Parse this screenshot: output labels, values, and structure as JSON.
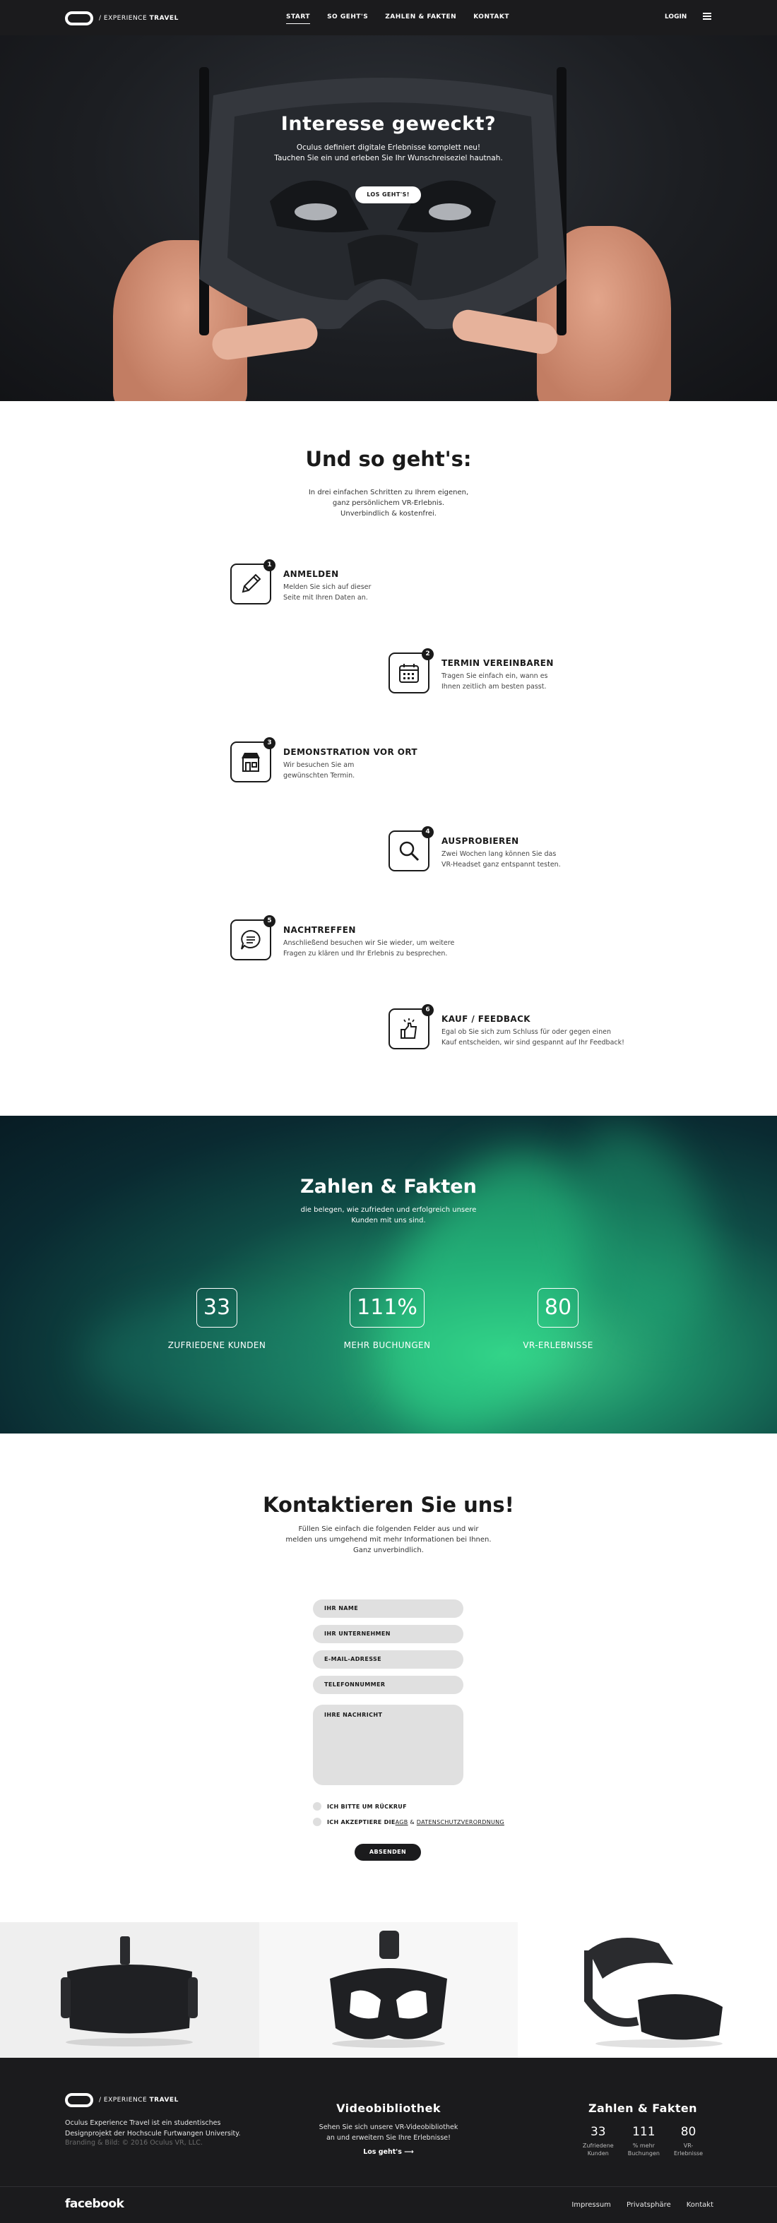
{
  "nav": {
    "logo_prefix": "/ EXPERIENCE ",
    "logo_bold": "TRAVEL",
    "links": [
      "START",
      "SO GEHT'S",
      "ZAHLEN & FAKTEN",
      "KONTAKT"
    ],
    "login": "LOGIN"
  },
  "hero": {
    "title": "Interesse geweckt?",
    "subtitle_line1": "Oculus definiert digitale Erlebnisse komplett neu!",
    "subtitle_line2": "Tauchen Sie ein und erleben Sie Ihr Wunschreiseziel hautnah.",
    "button": "LOS GEHT'S!"
  },
  "steps": {
    "title": "Und so geht's:",
    "subtitle_lines": [
      "In drei einfachen Schritten zu Ihrem eigenen,",
      "ganz persönlichem VR-Erlebnis.",
      "Unverbindlich & kostenfrei."
    ],
    "items": [
      {
        "num": "1",
        "title": "ANMELDEN",
        "desc_lines": [
          "Melden Sie sich auf dieser",
          "Seite mit Ihren Daten an."
        ],
        "icon": "pencil-icon"
      },
      {
        "num": "2",
        "title": "TERMIN VEREINBAREN",
        "desc_lines": [
          "Tragen Sie einfach ein, wann es",
          "Ihnen zeitlich am besten passt."
        ],
        "icon": "calendar-icon"
      },
      {
        "num": "3",
        "title": "DEMONSTRATION VOR ORT",
        "desc_lines": [
          "Wir besuchen Sie am",
          "gewünschten Termin."
        ],
        "icon": "store-icon"
      },
      {
        "num": "4",
        "title": "AUSPROBIEREN",
        "desc_lines": [
          "Zwei Wochen lang können Sie das",
          "VR-Headset ganz entspannt testen."
        ],
        "icon": "magnifier-icon"
      },
      {
        "num": "5",
        "title": "NACHTREFFEN",
        "desc_lines": [
          "Anschließend besuchen wir Sie wieder, um weitere",
          "Fragen zu klären und Ihr Erlebnis zu besprechen."
        ],
        "icon": "chat-icon"
      },
      {
        "num": "6",
        "title": "KAUF / FEEDBACK",
        "desc_lines": [
          "Egal ob Sie sich zum Schluss für oder gegen einen",
          "Kauf entscheiden, wir sind gespannt auf Ihr Feedback!"
        ],
        "icon": "thumbs-up-icon"
      }
    ]
  },
  "facts": {
    "title": "Zahlen & Fakten",
    "subtitle_lines": [
      "die belegen, wie zufrieden und erfolgreich unsere",
      "Kunden mit uns sind."
    ],
    "stats": [
      {
        "value": "33",
        "label": "ZUFRIEDENE KUNDEN"
      },
      {
        "value": "111%",
        "label": "MEHR BUCHUNGEN"
      },
      {
        "value": "80",
        "label": "VR-ERLEBNISSE"
      }
    ]
  },
  "contact": {
    "title": "Kontaktieren Sie uns!",
    "subtitle_lines": [
      "Füllen Sie einfach die folgenden Felder aus und wir",
      "melden uns umgehend mit mehr Informationen bei Ihnen.",
      "Ganz unverbindlich."
    ],
    "fields": [
      "IHR NAME",
      "IHR UNTERNEHMEN",
      "E-MAIL-ADRESSE",
      "TELEFONNUMMER"
    ],
    "message": "IHRE NACHRICHT",
    "check1": "ICH BITTE UM RÜCKRUF",
    "check2_a": "ICH AKZEPTIERE DIE ",
    "check2_agb": "AGB",
    "check2_and": " & ",
    "check2_ds": "DATENSCHUTZVERORDNUNG",
    "submit": "ABSENDEN"
  },
  "footer": {
    "logo_prefix": "/ EXPERIENCE ",
    "logo_bold": "TRAVEL",
    "about_lines": [
      "Oculus Experience Travel ist ein studentisches",
      "Designprojekt der Hochscule Furtwangen University."
    ],
    "copyright": "Branding & Bild: © 2016 Oculus VR, LLC.",
    "mid_title": "Videobibliothek",
    "mid_lines": [
      "Sehen Sie sich unsere VR-Videobibliothek",
      "an und erweitern Sie Ihre Erlebnisse!"
    ],
    "mid_link": "Los geht's",
    "right_title": "Zahlen & Fakten",
    "stats": [
      {
        "value": "33",
        "label_lines": [
          "Zufriedene",
          "Kunden"
        ]
      },
      {
        "value": "111",
        "label_lines": [
          "% mehr",
          "Buchungen"
        ]
      },
      {
        "value": "80",
        "label_lines": [
          "VR-",
          "Erlebnisse"
        ]
      }
    ],
    "facebook": "facebook",
    "links": [
      "Impressum",
      "Privatsphäre",
      "Kontakt"
    ]
  },
  "colors": {
    "dark": "#1b1b1d",
    "field_bg": "#e0e0e0",
    "aurora_green": "#3dd48a"
  }
}
